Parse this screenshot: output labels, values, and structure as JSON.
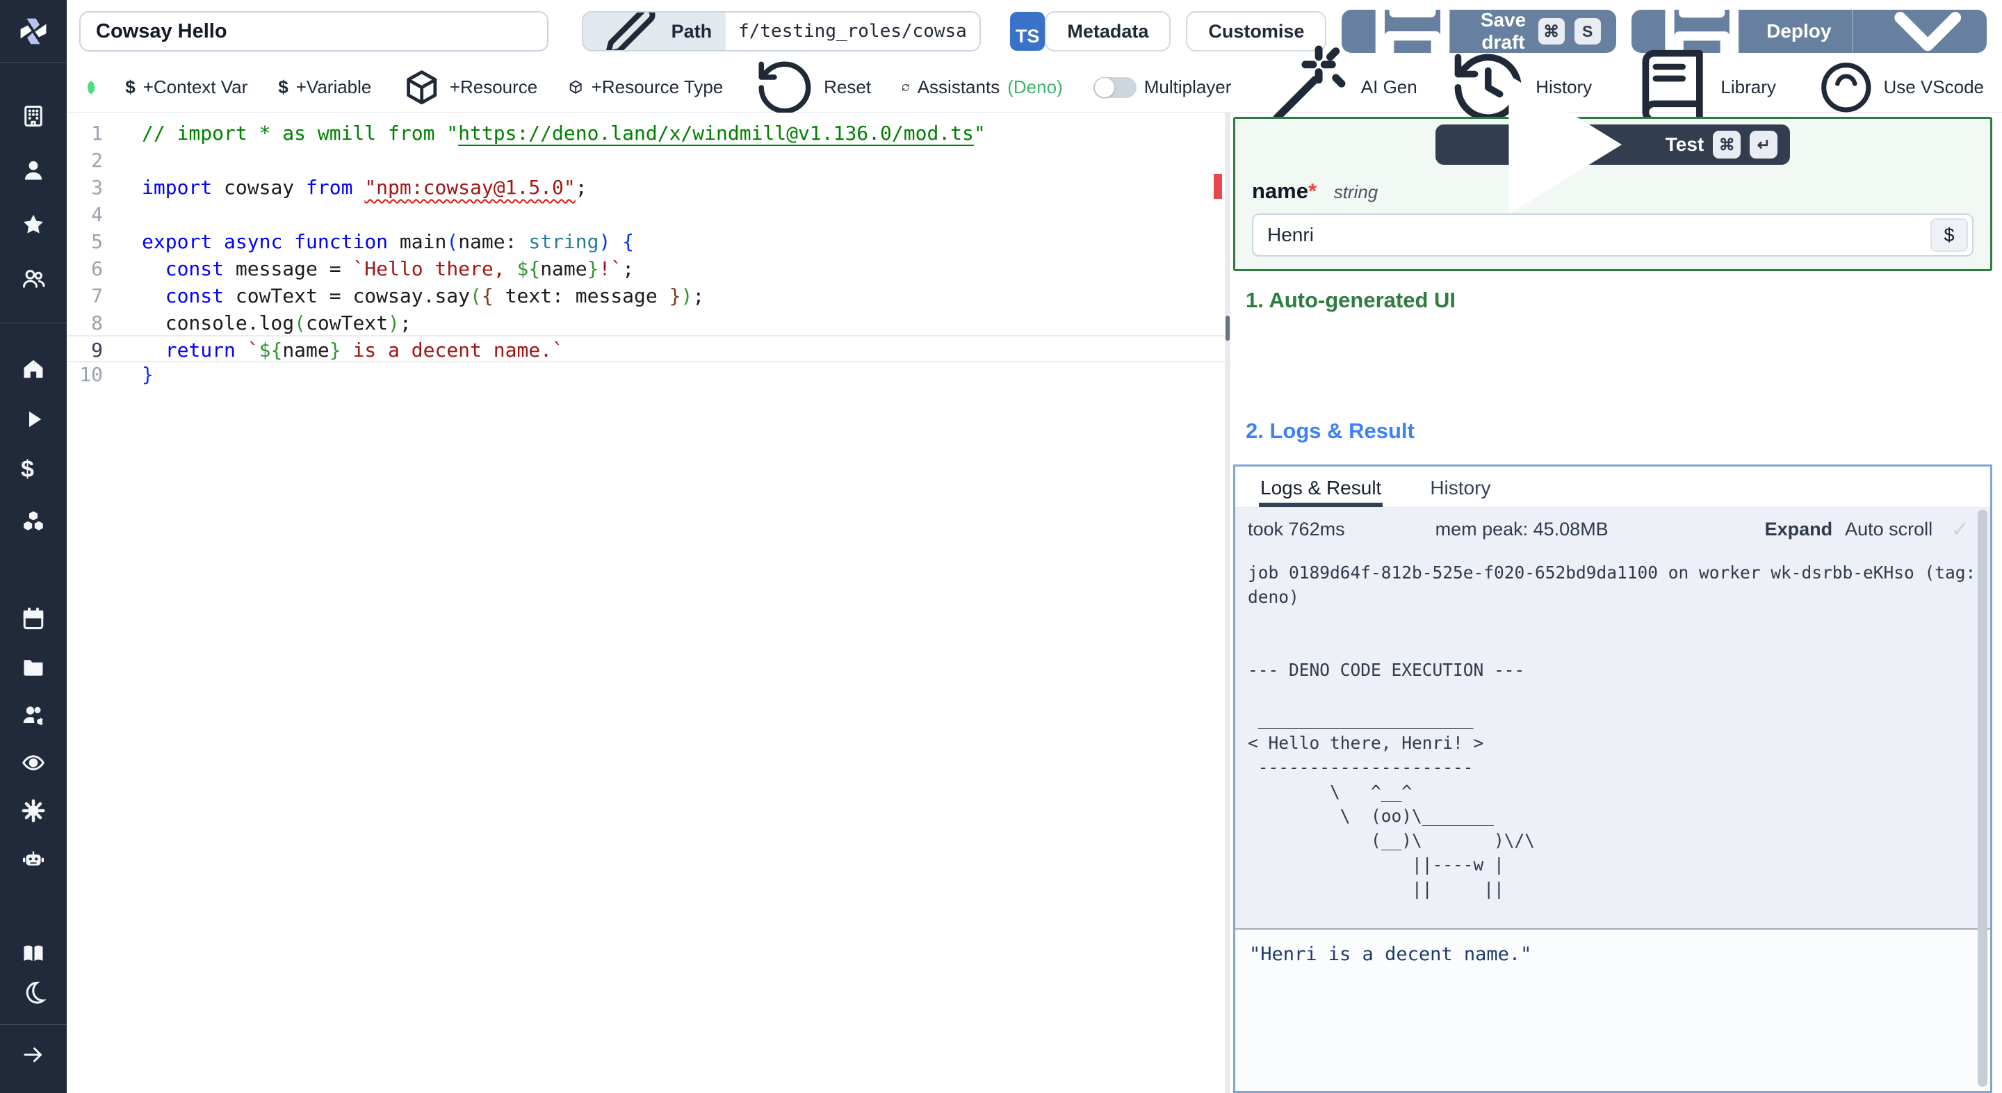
{
  "topbar": {
    "title_value": "Cowsay Hello",
    "path_label": "Path",
    "path_value": "f/testing_roles/cowsa",
    "lang_badge": "TS",
    "metadata_label": "Metadata",
    "customise_label": "Customise",
    "save_draft_label": "Save draft",
    "save_kbd1": "⌘",
    "save_kbd2": "S",
    "deploy_label": "Deploy"
  },
  "toolbar": {
    "status_dot_color": "#4ade80",
    "items": [
      {
        "icon": "dollar",
        "label": "+Context Var"
      },
      {
        "icon": "dollar",
        "label": "+Variable"
      },
      {
        "icon": "package",
        "label": "+Resource"
      },
      {
        "icon": "package",
        "label": "+Resource Type"
      },
      {
        "icon": "reset",
        "label": "Reset"
      },
      {
        "icon": "refresh",
        "label": "Assistants ",
        "suffix": "(Deno)"
      }
    ],
    "multiplayer_label": "Multiplayer",
    "ai_gen_label": "AI Gen",
    "right_items": [
      {
        "icon": "history",
        "label": "History"
      },
      {
        "icon": "library",
        "label": "Library"
      },
      {
        "icon": "vscode",
        "label": "Use VScode"
      }
    ]
  },
  "sidebar": {
    "groups": [
      [
        {
          "name": "workspace",
          "icon": "building"
        },
        {
          "name": "account",
          "icon": "user"
        },
        {
          "name": "favorites",
          "icon": "star"
        },
        {
          "name": "members",
          "icon": "users"
        }
      ],
      [
        {
          "name": "home",
          "icon": "home"
        },
        {
          "name": "runs",
          "icon": "play"
        },
        {
          "name": "variables",
          "icon": "dollar"
        },
        {
          "name": "resources",
          "icon": "cubes"
        }
      ],
      [
        {
          "name": "schedules",
          "icon": "calendar"
        },
        {
          "name": "folders",
          "icon": "folder"
        },
        {
          "name": "groups",
          "icon": "users-gear"
        },
        {
          "name": "audit-logs",
          "icon": "eye"
        },
        {
          "name": "settings",
          "icon": "gear"
        },
        {
          "name": "workers",
          "icon": "robot"
        }
      ],
      [
        {
          "name": "docs",
          "icon": "book-open"
        },
        {
          "name": "dark-mode",
          "icon": "moon"
        }
      ],
      [
        {
          "name": "expand",
          "icon": "arrow-right"
        }
      ]
    ]
  },
  "editor": {
    "lines": [
      {
        "n": "1",
        "tokens": [
          [
            "c",
            "// import * as wmill from \""
          ],
          [
            "cl",
            "https://deno.land/x/windmill@v1.136.0/mod.ts"
          ],
          [
            "c",
            "\""
          ]
        ]
      },
      {
        "n": "2",
        "tokens": []
      },
      {
        "n": "3",
        "tokens": [
          [
            "k",
            "import"
          ],
          [
            "p",
            " cowsay "
          ],
          [
            "k",
            "from"
          ],
          [
            "p",
            " "
          ],
          [
            "sq",
            "\"npm:cowsay@1.5.0\""
          ],
          [
            "p",
            ";"
          ]
        ]
      },
      {
        "n": "4",
        "tokens": []
      },
      {
        "n": "5",
        "tokens": [
          [
            "k",
            "export"
          ],
          [
            "p",
            " "
          ],
          [
            "k",
            "async"
          ],
          [
            "p",
            " "
          ],
          [
            "k",
            "function"
          ],
          [
            "p",
            " main"
          ],
          [
            "b1",
            "("
          ],
          [
            "p",
            "name: "
          ],
          [
            "t",
            "string"
          ],
          [
            "b1",
            ")"
          ],
          [
            "p",
            " "
          ],
          [
            "b1",
            "{"
          ]
        ]
      },
      {
        "n": "6",
        "tokens": [
          [
            "p",
            "  "
          ],
          [
            "k",
            "const"
          ],
          [
            "p",
            " message = "
          ],
          [
            "s",
            "`Hello there, "
          ],
          [
            "b2",
            "${"
          ],
          [
            "p",
            "name"
          ],
          [
            "b2",
            "}"
          ],
          [
            "s",
            "!`"
          ],
          [
            "p",
            ";"
          ]
        ]
      },
      {
        "n": "7",
        "tokens": [
          [
            "p",
            "  "
          ],
          [
            "k",
            "const"
          ],
          [
            "p",
            " cowText = cowsay.say"
          ],
          [
            "b2",
            "("
          ],
          [
            "b3",
            "{"
          ],
          [
            "p",
            " text: message "
          ],
          [
            "b3",
            "}"
          ],
          [
            "b2",
            ")"
          ],
          [
            "p",
            ";"
          ]
        ]
      },
      {
        "n": "8",
        "tokens": [
          [
            "p",
            "  console.log"
          ],
          [
            "b2",
            "("
          ],
          [
            "p",
            "cowText"
          ],
          [
            "b2",
            ")"
          ],
          [
            "p",
            ";"
          ]
        ]
      },
      {
        "n": "9",
        "current": true,
        "tokens": [
          [
            "p",
            "  "
          ],
          [
            "k",
            "return"
          ],
          [
            "p",
            " "
          ],
          [
            "s",
            "`"
          ],
          [
            "b2",
            "${"
          ],
          [
            "p",
            "name"
          ],
          [
            "b2",
            "}"
          ],
          [
            "s",
            " is a decent name.`"
          ]
        ]
      },
      {
        "n": "10",
        "tokens": [
          [
            "b1",
            "}"
          ]
        ]
      }
    ]
  },
  "panel": {
    "test_label": "Test",
    "test_kbd1": "⌘",
    "test_kbd2": "↵",
    "arg": {
      "name": "name",
      "required": "*",
      "type": "string",
      "value": "Henri",
      "var_button": "$"
    },
    "section1": "1. Auto-generated UI",
    "section2": "2. Logs & Result",
    "tabs": [
      "Logs & Result",
      "History"
    ],
    "stats": {
      "took": "took 762ms",
      "mem": "mem peak: 45.08MB",
      "expand": "Expand",
      "autoscroll": "Auto scroll",
      "check": "✓"
    },
    "log_text": "job 0189d64f-812b-525e-f020-652bd9da1100 on worker wk-dsrbb-eKHso (tag:\ndeno)\n\n\n--- DENO CODE EXECUTION ---\n\n _____________________\n< Hello there, Henri! >\n ---------------------\n        \\   ^__^\n         \\  (oo)\\_______\n            (__)\\       )\\/\\\n                ||----w |\n                ||     ||",
    "result_text": "\"Henri is a decent name.\""
  }
}
